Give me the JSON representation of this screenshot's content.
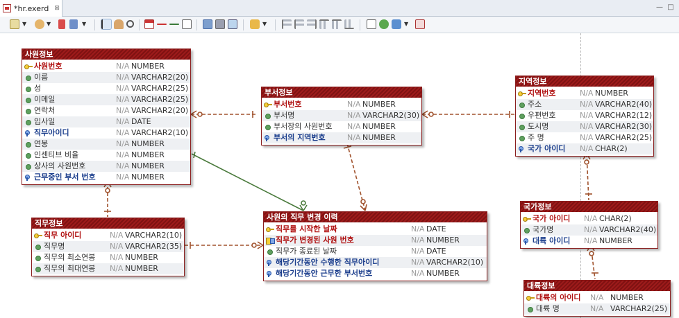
{
  "editor": {
    "tab_title": "*hr.exerd",
    "close_glyph": "⊠",
    "minimize_glyph": "—",
    "maximize_glyph": "□"
  },
  "toolbar": {
    "icons": [
      "view-icon",
      "paint-icon",
      "delete-icon",
      "report-icon",
      "select-icon",
      "hand-icon",
      "zoom-icon",
      "table-icon",
      "relation-icon",
      "identifying-relation-icon",
      "note-icon",
      "layout-icon",
      "auto-layout-icon",
      "image-icon",
      "export-icon",
      "align-left-icon",
      "align-center-icon",
      "align-right-icon",
      "align-top-icon",
      "align-middle-icon",
      "align-bottom-icon",
      "document-icon",
      "check-icon",
      "generate-icon",
      "settings-icon"
    ]
  },
  "colors": {
    "entity_header": "#9e1b1b",
    "pk_text": "#b01010",
    "fk_text": "#1a3d8c",
    "relationship_dashed": "#a0522d",
    "relationship_solid": "#4a7a3c"
  },
  "entities": {
    "employee": {
      "title": "사원정보",
      "columns": [
        {
          "name": "사원번호",
          "key": "pk",
          "nullable": "N/A",
          "type": "NUMBER"
        },
        {
          "name": "이름",
          "key": "none",
          "nullable": "N/A",
          "type": "VARCHAR2(20)"
        },
        {
          "name": "성",
          "key": "none",
          "nullable": "N/A",
          "type": "VARCHAR2(25)"
        },
        {
          "name": "이메일",
          "key": "none",
          "nullable": "N/A",
          "type": "VARCHAR2(25)"
        },
        {
          "name": "연락처",
          "key": "none",
          "nullable": "N/A",
          "type": "VARCHAR2(20)"
        },
        {
          "name": "입사일",
          "key": "none",
          "nullable": "N/A",
          "type": "DATE"
        },
        {
          "name": "직무아이디",
          "key": "fk",
          "nullable": "N/A",
          "type": "VARCHAR2(10)"
        },
        {
          "name": "연봉",
          "key": "none",
          "nullable": "N/A",
          "type": "NUMBER"
        },
        {
          "name": "인센티브 비율",
          "key": "none",
          "nullable": "N/A",
          "type": "NUMBER"
        },
        {
          "name": "상사의 사원번호",
          "key": "none",
          "nullable": "N/A",
          "type": "NUMBER"
        },
        {
          "name": "근무중인 부서 번호",
          "key": "fk",
          "nullable": "N/A",
          "type": "NUMBER"
        }
      ]
    },
    "department": {
      "title": "부서정보",
      "columns": [
        {
          "name": "부서번호",
          "key": "pk",
          "nullable": "N/A",
          "type": "NUMBER"
        },
        {
          "name": "부서명",
          "key": "none",
          "nullable": "N/A",
          "type": "VARCHAR2(30)"
        },
        {
          "name": "부서장의 사원번호",
          "key": "none",
          "nullable": "N/A",
          "type": "NUMBER"
        },
        {
          "name": "부서의 지역번호",
          "key": "fk",
          "nullable": "N/A",
          "type": "NUMBER"
        }
      ]
    },
    "location": {
      "title": "지역정보",
      "columns": [
        {
          "name": "지역번호",
          "key": "pk",
          "nullable": "N/A",
          "type": "NUMBER"
        },
        {
          "name": "주소",
          "key": "none",
          "nullable": "N/A",
          "type": "VARCHAR2(40)"
        },
        {
          "name": "우편번호",
          "key": "none",
          "nullable": "N/A",
          "type": "VARCHAR2(12)"
        },
        {
          "name": "도시명",
          "key": "none",
          "nullable": "N/A",
          "type": "VARCHAR2(30)"
        },
        {
          "name": "주 명",
          "key": "none",
          "nullable": "N/A",
          "type": "VARCHAR2(25)"
        },
        {
          "name": "국가 아이디",
          "key": "fk",
          "nullable": "N/A",
          "type": "CHAR(2)"
        }
      ]
    },
    "job": {
      "title": "직무정보",
      "columns": [
        {
          "name": "직무 아이디",
          "key": "pk",
          "nullable": "N/A",
          "type": "VARCHAR2(10)"
        },
        {
          "name": "직무명",
          "key": "none",
          "nullable": "N/A",
          "type": "VARCHAR2(35)"
        },
        {
          "name": "직무의 최소연봉",
          "key": "none",
          "nullable": "N/A",
          "type": "NUMBER"
        },
        {
          "name": "직무의 최대연봉",
          "key": "none",
          "nullable": "N/A",
          "type": "NUMBER"
        }
      ]
    },
    "job_history": {
      "title": "사원의 직무 변경 이력",
      "columns": [
        {
          "name": "직무를 시작한 날짜",
          "key": "pk",
          "nullable": "N/A",
          "type": "DATE"
        },
        {
          "name": "직무가 변경된 사원 번호",
          "key": "pkfk",
          "nullable": "N/A",
          "type": "NUMBER"
        },
        {
          "name": "직무가 종료된 날짜",
          "key": "none",
          "nullable": "N/A",
          "type": "DATE"
        },
        {
          "name": "해당기간동안 수행한 직무아이디",
          "key": "fk",
          "nullable": "N/A",
          "type": "VARCHAR2(10)"
        },
        {
          "name": "해당기간동안 근무한 부서번호",
          "key": "fk",
          "nullable": "N/A",
          "type": "NUMBER"
        }
      ]
    },
    "country": {
      "title": "국가정보",
      "columns": [
        {
          "name": "국가 아이디",
          "key": "pk",
          "nullable": "N/A",
          "type": "CHAR(2)"
        },
        {
          "name": "국가명",
          "key": "none",
          "nullable": "N/A",
          "type": "VARCHAR2(40)"
        },
        {
          "name": "대륙 아이디",
          "key": "fk",
          "nullable": "N/A",
          "type": "NUMBER"
        }
      ]
    },
    "region": {
      "title": "대륙정보",
      "columns": [
        {
          "name": "대륙의 아이디",
          "key": "pk",
          "nullable": "N/A",
          "type": "NUMBER"
        },
        {
          "name": "대륙 명",
          "key": "none",
          "nullable": "N/A",
          "type": "VARCHAR2(25)"
        }
      ]
    }
  }
}
